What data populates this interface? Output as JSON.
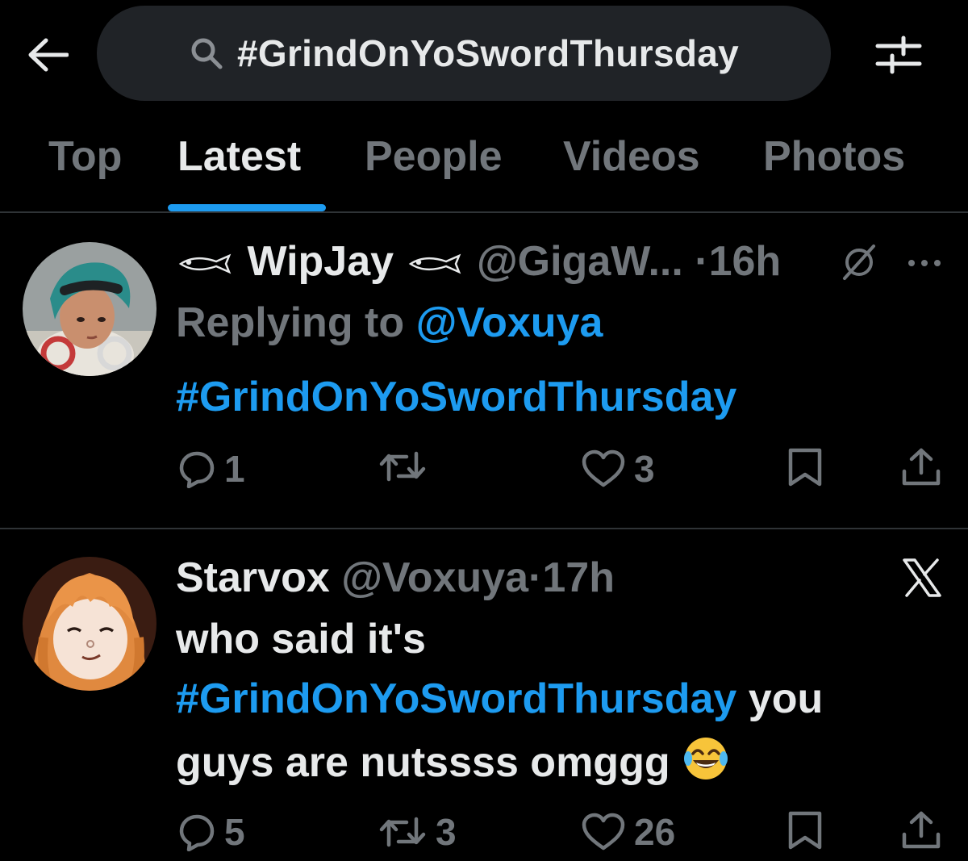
{
  "header": {
    "back_icon": "back-arrow-icon",
    "search_icon": "search-icon",
    "search_query": "#GrindOnYoSwordThursday",
    "filter_icon": "filter-sliders-icon"
  },
  "tabs": [
    {
      "label": "Top",
      "active": false
    },
    {
      "label": "Latest",
      "active": true
    },
    {
      "label": "People",
      "active": false
    },
    {
      "label": "Videos",
      "active": false
    },
    {
      "label": "Photos",
      "active": false
    }
  ],
  "posts": [
    {
      "display_name": "WipJay",
      "handle": "@GigaW...",
      "sep": "·",
      "time": "16h",
      "replying_prefix": "Replying to ",
      "replying_to": "@Voxuya",
      "body_hashtag": "#GrindOnYoSwordThursday",
      "replies": "1",
      "reposts": "",
      "likes": "3",
      "icons": [
        "reply-icon",
        "repost-icon",
        "like-icon",
        "bookmark-icon",
        "share-icon",
        "grok-icon",
        "more-icon",
        "fish-icon"
      ]
    },
    {
      "display_name": "Starvox",
      "handle": "@Voxuya",
      "sep": "·",
      "time": "17h",
      "text_1": "who said it's",
      "body_hashtag": "#GrindOnYoSwordThursday",
      "text_2": " you",
      "text_3": "guys are nutssss omggg ",
      "replies": "5",
      "reposts": "3",
      "likes": "26",
      "icons": [
        "reply-icon",
        "repost-icon",
        "like-icon",
        "bookmark-icon",
        "share-icon",
        "x-logo-icon",
        "laughing-emoji-icon"
      ]
    }
  ],
  "colors": {
    "background": "#000000",
    "text": "#e7e9ea",
    "secondary": "#71767b",
    "accent": "#1d9bf0",
    "divider": "#2f3336",
    "search_bg": "#202327"
  }
}
